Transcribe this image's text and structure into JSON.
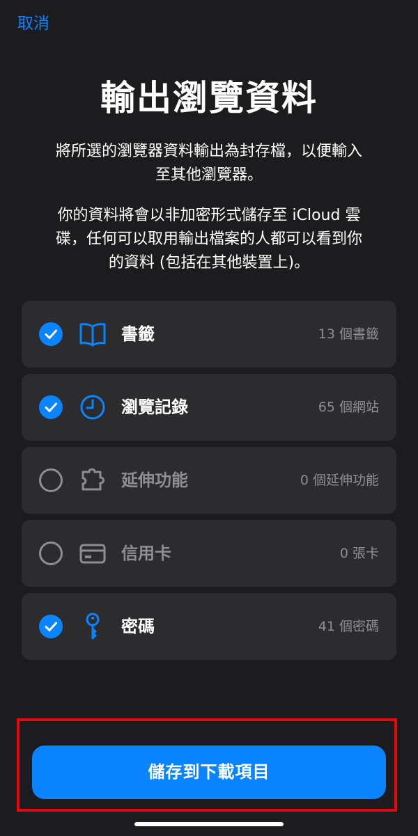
{
  "header": {
    "cancel_label": "取消"
  },
  "main": {
    "title": "輸出瀏覽資料",
    "description_1": "將所選的瀏覽器資料輸出為封存檔，以便輸入至其他瀏覽器。",
    "description_2": "你的資料將會以非加密形式儲存至 iCloud 雲碟，任何可以取用輸出檔案的人都可以看到你的資料 (包括在其他裝置上)。"
  },
  "items": [
    {
      "label": "書籤",
      "count": "13 個書籤",
      "selected": true,
      "icon": "book-icon"
    },
    {
      "label": "瀏覽記錄",
      "count": "65 個網站",
      "selected": true,
      "icon": "clock-icon"
    },
    {
      "label": "延伸功能",
      "count": "0 個延伸功能",
      "selected": false,
      "icon": "puzzle-icon"
    },
    {
      "label": "信用卡",
      "count": "0 張卡",
      "selected": false,
      "icon": "credit-card-icon"
    },
    {
      "label": "密碼",
      "count": "41 個密碼",
      "selected": true,
      "icon": "key-icon"
    }
  ],
  "footer": {
    "save_label": "儲存到下載項目"
  },
  "colors": {
    "accent": "#0a84ff",
    "background": "#1c1c1e",
    "row_background": "#2c2c2e",
    "secondary_text": "#8e8e93",
    "highlight": "#e50914"
  }
}
